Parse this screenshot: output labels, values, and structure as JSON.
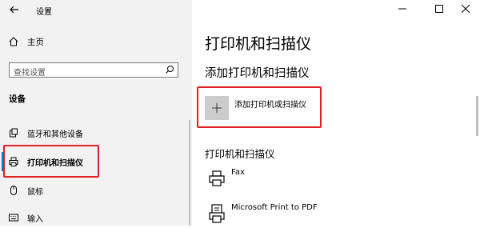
{
  "window": {
    "title": "设置",
    "minimize_icon": "minimize-icon",
    "maximize_icon": "maximize-icon",
    "close_icon": "close-icon"
  },
  "sidebar": {
    "home_label": "主页",
    "search_placeholder": "查找设置",
    "section_label": "设备",
    "items": [
      {
        "label": "蓝牙和其他设备",
        "icon": "bluetooth-devices-icon",
        "selected": false
      },
      {
        "label": "打印机和扫描仪",
        "icon": "printer-icon",
        "selected": true
      },
      {
        "label": "鼠标",
        "icon": "mouse-icon",
        "selected": false
      },
      {
        "label": "输入",
        "icon": "keyboard-icon",
        "selected": false
      }
    ]
  },
  "main": {
    "title": "打印机和扫描仪",
    "add_section_title": "添加打印机和扫描仪",
    "add_button_label": "添加打印机或扫描仪",
    "list_title": "打印机和扫描仪",
    "printers": [
      {
        "name": "Fax",
        "icon": "fax-icon"
      },
      {
        "name": "Microsoft Print to PDF",
        "icon": "pdf-printer-icon"
      }
    ]
  },
  "colors": {
    "accent": "#0078d7",
    "highlight": "#e02020",
    "sidebar_bg": "#f2f2f2"
  }
}
